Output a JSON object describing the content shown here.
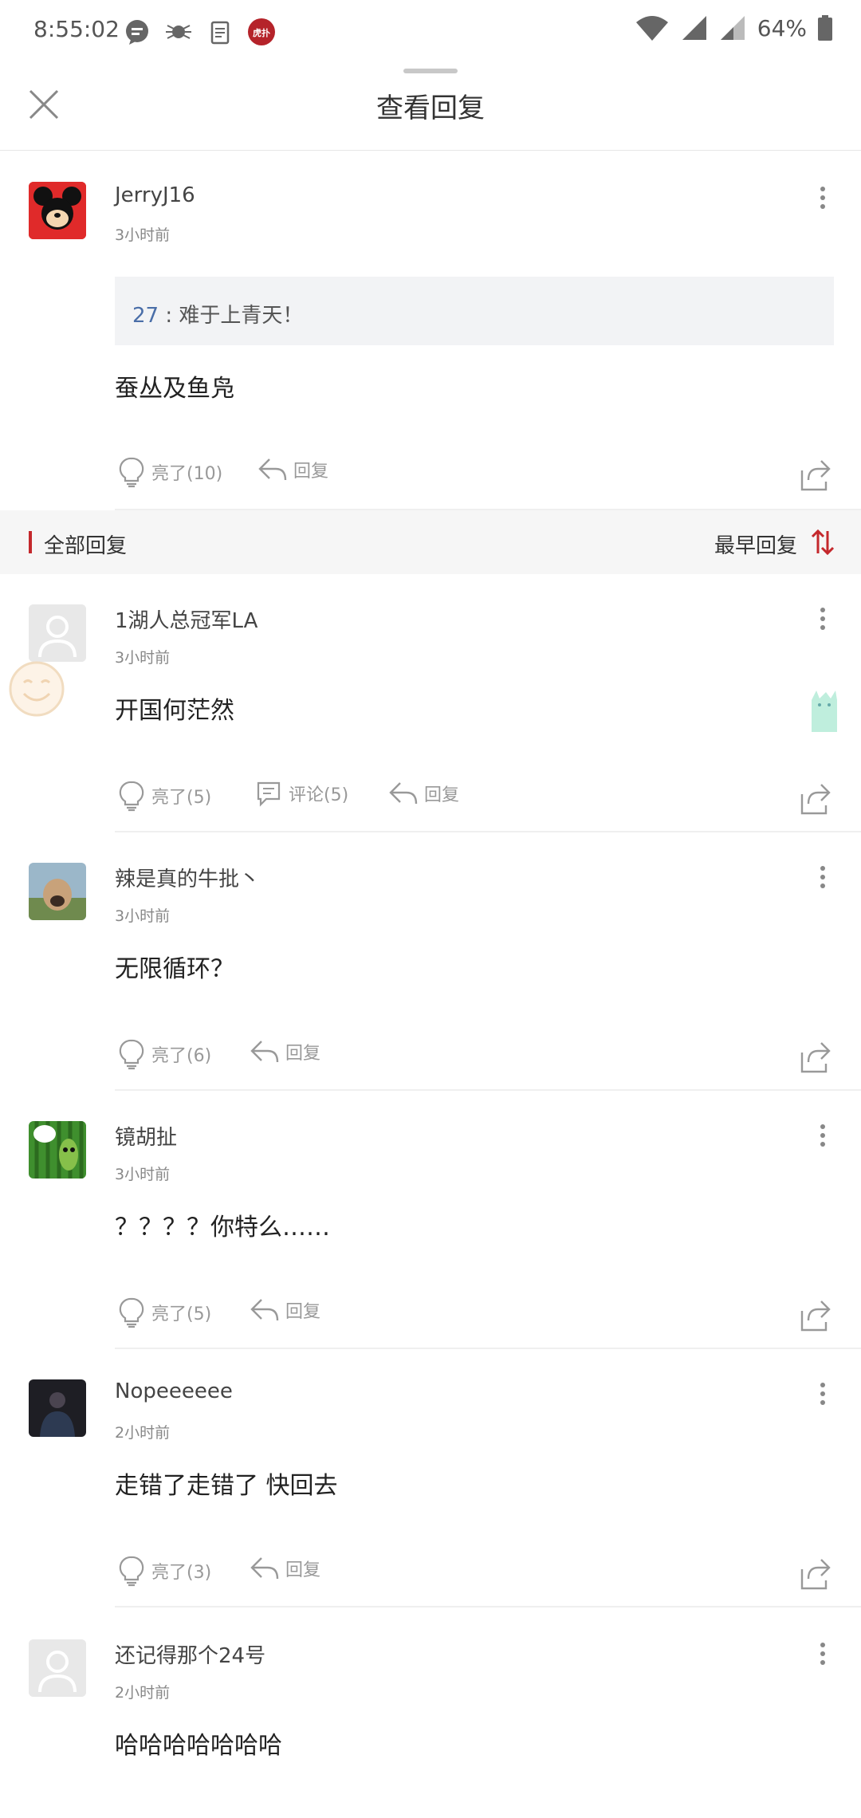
{
  "status_bar": {
    "time": "8:55:02",
    "battery": "64%",
    "icons": [
      "message-icon",
      "spider-icon",
      "document-icon",
      "app-badge-icon",
      "wifi-icon",
      "signal-icon",
      "signal-icon",
      "battery-icon"
    ],
    "app_badge_text": "虎扑"
  },
  "header": {
    "title": "查看回复"
  },
  "original": {
    "username": "JerryJ16",
    "time": "3小时前",
    "quote_num": "27",
    "quote_sep": " : ",
    "quote_text": "难于上青天！",
    "content": "蚕丛及鱼凫",
    "like_label": "亮了(10)",
    "reply_label": "回复"
  },
  "section": {
    "title": "全部回复",
    "sort_label": "最早回复"
  },
  "replies": [
    {
      "username": "1湖人总冠军LA",
      "time": "3小时前",
      "content": "开国何茫然",
      "like_label": "亮了(5)",
      "comment_label": "评论(5)",
      "reply_label": "回复"
    },
    {
      "username": "辣是真的牛批丶",
      "time": "3小时前",
      "content": "无限循环？",
      "like_label": "亮了(6)",
      "reply_label": "回复"
    },
    {
      "username": "镜胡扯",
      "time": "3小时前",
      "content": "？？？？你特么……",
      "like_label": "亮了(5)",
      "reply_label": "回复"
    },
    {
      "username": "Nopeeeeee",
      "time": "2小时前",
      "content": "走错了走错了 快回去",
      "like_label": "亮了(3)",
      "reply_label": "回复"
    },
    {
      "username": "还记得那个24号",
      "time": "2小时前",
      "content": "哈哈哈哈哈哈哈",
      "like_label": "",
      "reply_label": ""
    }
  ],
  "colors": {
    "accent": "#c4282c",
    "quote_num": "#4a6ea8",
    "muted": "#999999"
  }
}
